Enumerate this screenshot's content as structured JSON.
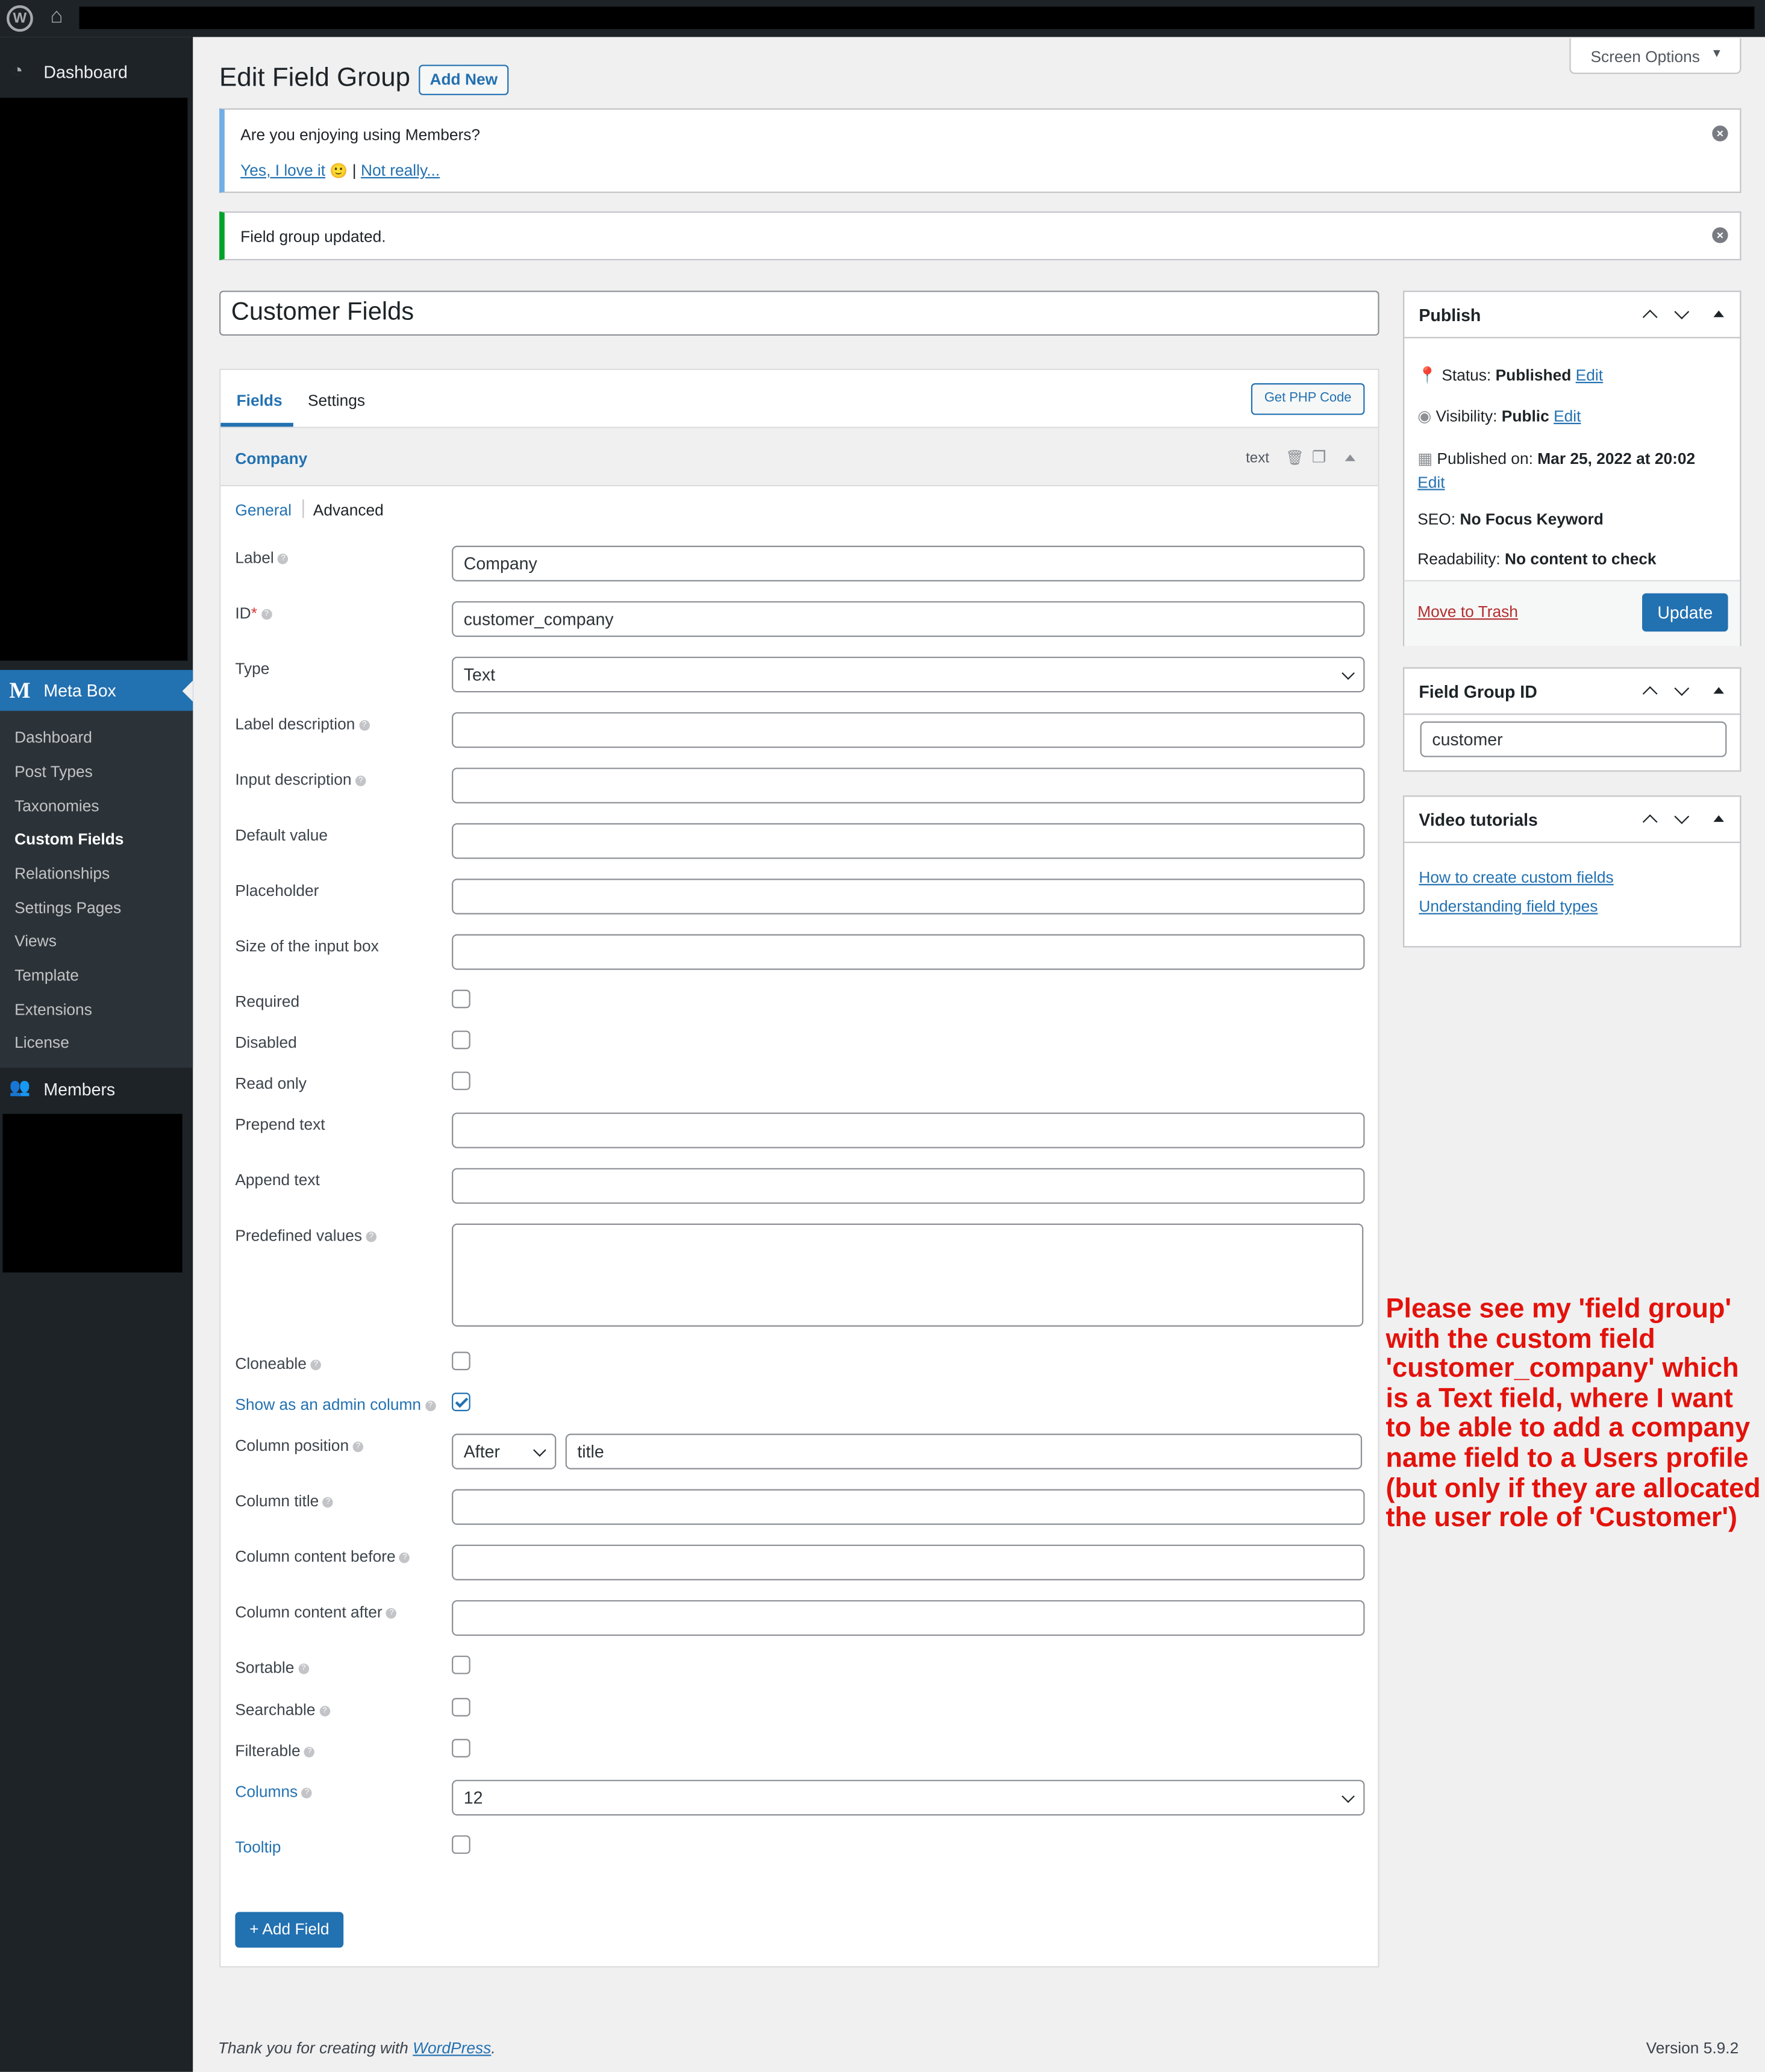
{
  "admin_bar": {
    "wp_label": "W",
    "home_icon": "home-icon"
  },
  "sidebar": {
    "dashboard": "Dashboard",
    "meta_box": "Meta Box",
    "submenu": [
      "Dashboard",
      "Post Types",
      "Taxonomies",
      "Custom Fields",
      "Relationships",
      "Settings Pages",
      "Views",
      "Template",
      "Extensions",
      "License"
    ],
    "current": "Custom Fields",
    "members": "Members"
  },
  "header": {
    "title": "Edit Field Group",
    "add_new": "Add New",
    "screen_options": "Screen Options"
  },
  "notice_members": {
    "question": "Are you enjoying using Members?",
    "yes": "Yes, I love it",
    "emoji": "🙂",
    "sep": "|",
    "no": "Not really..."
  },
  "notice_updated": {
    "text": "Field group updated."
  },
  "group_title": "Customer Fields",
  "tabs": {
    "fields": "Fields",
    "settings": "Settings",
    "php": "Get PHP Code"
  },
  "field": {
    "name": "Company",
    "type_badge": "text",
    "subtabs": {
      "general": "General",
      "advanced": "Advanced"
    },
    "labels": {
      "label": "Label",
      "id": "ID",
      "id_star": "*",
      "type": "Type",
      "label_description": "Label description",
      "input_description": "Input description",
      "default_value": "Default value",
      "placeholder": "Placeholder",
      "size": "Size of the input box",
      "required": "Required",
      "disabled": "Disabled",
      "read_only": "Read only",
      "prepend": "Prepend text",
      "append": "Append text",
      "predefined": "Predefined values",
      "cloneable": "Cloneable",
      "admin_column": "Show as an admin column",
      "column_position": "Column position",
      "column_title": "Column title",
      "column_before": "Column content before",
      "column_after": "Column content after",
      "sortable": "Sortable",
      "searchable": "Searchable",
      "filterable": "Filterable",
      "columns": "Columns",
      "tooltip": "Tooltip"
    },
    "values": {
      "label": "Company",
      "id": "customer_company",
      "type": "Text",
      "column_position_select": "After",
      "column_position_value": "title",
      "columns": "12"
    },
    "checkboxes": {
      "admin_column": true
    }
  },
  "add_field": "+ Add Field",
  "publish": {
    "title": "Publish",
    "status_label": "Status:",
    "status_value": "Published",
    "visibility_label": "Visibility:",
    "visibility_value": "Public",
    "published_label": "Published on:",
    "published_value": "Mar 25, 2022 at 20:02",
    "edit": "Edit",
    "seo_label": "SEO:",
    "seo_value": "No Focus Keyword",
    "readability_label": "Readability:",
    "readability_value": "No content to check",
    "trash": "Move to Trash",
    "update": "Update"
  },
  "field_group_id": {
    "title": "Field Group ID",
    "value": "customer"
  },
  "video": {
    "title": "Video tutorials",
    "links": [
      "How to create custom fields",
      "Understanding field types"
    ]
  },
  "annotation": "Please see my 'field group' with the custom field 'customer_company' which is a Text field, where I want to be able to add a company name field to a Users profile (but only if they are allocated the user role of 'Customer')",
  "footer": {
    "thanks": "Thank you for creating with",
    "wp": "WordPress",
    "dot": ".",
    "version": "Version 5.9.2"
  },
  "colors": {
    "accent": "#2271b1",
    "annotation": "#e3120b",
    "sidebar": "#1d2327"
  }
}
